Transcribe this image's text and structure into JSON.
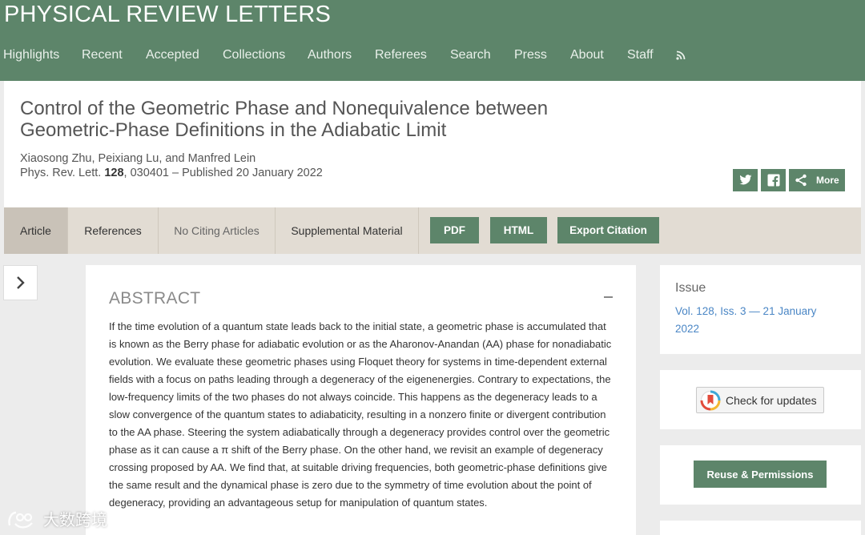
{
  "journal": {
    "title": "PHYSICAL REVIEW LETTERS"
  },
  "nav": [
    "Highlights",
    "Recent",
    "Accepted",
    "Collections",
    "Authors",
    "Referees",
    "Search",
    "Press",
    "About",
    "Staff"
  ],
  "article": {
    "title": "Control of the Geometric Phase and Nonequivalence between Geometric-Phase Definitions in the Adiabatic Limit",
    "authors": "Xiaosong Zhu, Peixiang Lu, and Manfred Lein",
    "journal_abbrev": "Phys. Rev. Lett.",
    "volume": "128",
    "citation_rest": ", 030401 – Published 20 January 2022"
  },
  "share": {
    "more_label": "More"
  },
  "tabs": {
    "article": "Article",
    "references": "References",
    "citing": "No Citing Articles",
    "supplemental": "Supplemental Material",
    "pdf": "PDF",
    "html": "HTML",
    "export": "Export Citation"
  },
  "abstract": {
    "heading": "ABSTRACT",
    "text": "If the time evolution of a quantum state leads back to the initial state, a geometric phase is accumulated that is known as the Berry phase for adiabatic evolution or as the Aharonov-Anandan (AA) phase for nonadiabatic evolution. We evaluate these geometric phases using Floquet theory for systems in time-dependent external fields with a focus on paths leading through a degeneracy of the eigenenergies. Contrary to expectations, the low-frequency limits of the two phases do not always coincide. This happens as the degeneracy leads to a slow convergence of the quantum states to adiabaticity, resulting in a nonzero finite or divergent contribution to the AA phase. Steering the system adiabatically through a degeneracy provides control over the geometric phase as it can cause a π shift of the Berry phase. On the other hand, we revisit an example of degeneracy crossing proposed by AA. We find that, at suitable driving frequencies, both geometric-phase definitions give the same result and the dynamical phase is zero due to the symmetry of time evolution about the point of degeneracy, providing an advantageous setup for manipulation of quantum states."
  },
  "sidebar": {
    "issue_label": "Issue",
    "issue_link": "Vol. 128, Iss. 3 — 21 January 2022",
    "updates_label": "Check for updates",
    "reuse_label": "Reuse & Permissions"
  },
  "watermark": {
    "text": "大数跨境"
  },
  "colors": {
    "brand_green": "#5d856a",
    "tab_bg": "#e2dcd3",
    "link_blue": "#4a86c5",
    "page_bg": "#ececec"
  },
  "icons": [
    "rss-icon",
    "twitter-icon",
    "facebook-icon",
    "share-icon",
    "chevron-right-icon",
    "crossmark-icon",
    "collapse-icon"
  ]
}
